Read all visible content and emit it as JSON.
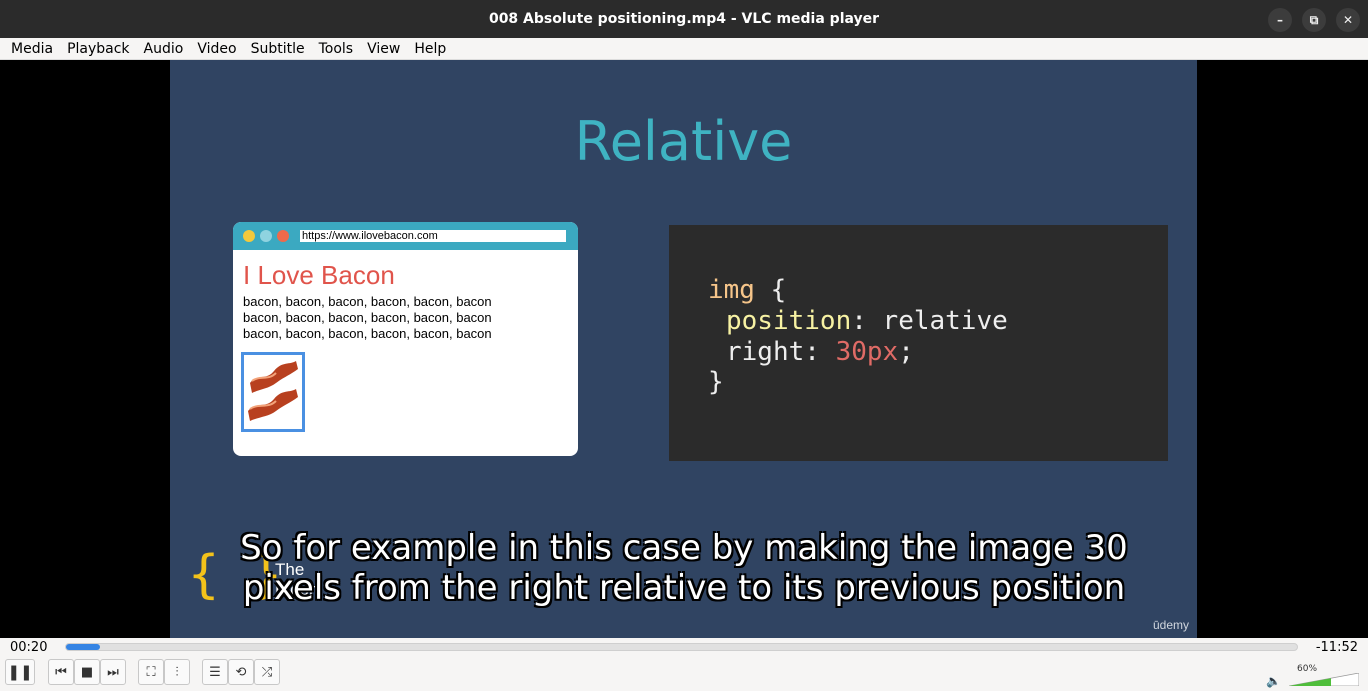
{
  "window": {
    "title": "008 Absolute positioning.mp4 - VLC media player",
    "controls": {
      "minimize": "–",
      "maximize": "⧉",
      "close": "✕"
    }
  },
  "menu": [
    "Media",
    "Playback",
    "Audio",
    "Video",
    "Subtitle",
    "Tools",
    "View",
    "Help"
  ],
  "slide": {
    "title": "Relative",
    "mock_browser": {
      "url": "https://www.ilovebacon.com",
      "heading": "I Love Bacon",
      "lines": [
        "bacon, bacon, bacon, bacon, bacon, bacon",
        "bacon, bacon, bacon, bacon, bacon, bacon",
        "bacon, bacon, bacon, bacon, bacon, bacon"
      ]
    },
    "code": {
      "selector": "img",
      "open_brace": " {",
      "line1_prop": "position",
      "line1_rest": ": relative",
      "line2_prop": "right: ",
      "line2_value": "30px",
      "line2_end": ";",
      "close_brace": "}"
    },
    "logo": {
      "brace": "{ }",
      "line1": "The",
      "line2": "Bloom"
    },
    "watermark": "ūdemy"
  },
  "subtitles": {
    "line1": "So for example in this case by making the image 30",
    "line2": "pixels from the right relative to its previous position"
  },
  "player": {
    "time_elapsed": "00:20",
    "time_remaining": "-11:52",
    "progress_fraction": 0.028,
    "volume_label": "60%",
    "volume_fraction": 0.6,
    "buttons": {
      "play_pause": "❚❚",
      "prev": "⏮",
      "stop": "■",
      "next": "⏭",
      "fullscreen": "⛶",
      "extended": "⫶",
      "playlist": "☰",
      "loop": "⟲",
      "shuffle": "⤮"
    }
  },
  "colors": {
    "slide_bg": "#304462",
    "accent_title": "#3fb3c2",
    "bacon_red": "#e0544b",
    "code_bg": "#2b2b2b",
    "seek_fill": "#3584e4",
    "volume_fill": "#4fbe3a"
  }
}
